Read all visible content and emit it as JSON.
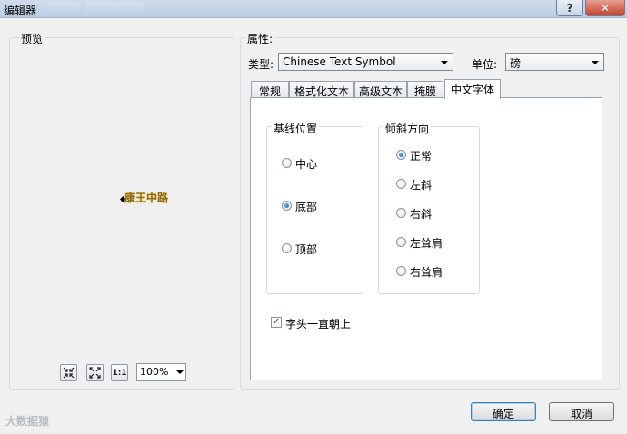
{
  "window": {
    "title": "编辑器",
    "help_label": "?",
    "close_label": "✕"
  },
  "preview": {
    "title": "预览",
    "sample_text": "康王中路",
    "zoom_value": "100%",
    "tools": [
      {
        "icon": "zoom-fit-icon",
        "glyph": "⇲"
      },
      {
        "icon": "full-extent-icon",
        "glyph": "⛶"
      },
      {
        "icon": "actual-size-icon",
        "glyph": "1:1"
      }
    ]
  },
  "properties": {
    "title": "属性:",
    "type_label": "类型:",
    "type_value": "Chinese Text Symbol",
    "unit_label": "单位:",
    "unit_value": "磅"
  },
  "tabs": [
    {
      "label": "常规",
      "active": false
    },
    {
      "label": "格式化文本",
      "active": false
    },
    {
      "label": "高级文本",
      "active": false
    },
    {
      "label": "掩膜",
      "active": false
    },
    {
      "label": "中文字体",
      "active": true
    }
  ],
  "baseline_group": {
    "title": "基线位置",
    "options": [
      {
        "label": "中心",
        "checked": false
      },
      {
        "label": "底部",
        "checked": true
      },
      {
        "label": "顶部",
        "checked": false
      }
    ]
  },
  "slant_group": {
    "title": "倾斜方向",
    "options": [
      {
        "label": "正常",
        "checked": true
      },
      {
        "label": "左斜",
        "checked": false
      },
      {
        "label": "右斜",
        "checked": false
      },
      {
        "label": "左耸肩",
        "checked": false
      },
      {
        "label": "右耸肩",
        "checked": false
      }
    ]
  },
  "upright_checkbox": {
    "label": "字头一直朝上",
    "checked": true
  },
  "buttons": {
    "ok": "确定",
    "cancel": "取消"
  },
  "watermark": "大数据猿"
}
